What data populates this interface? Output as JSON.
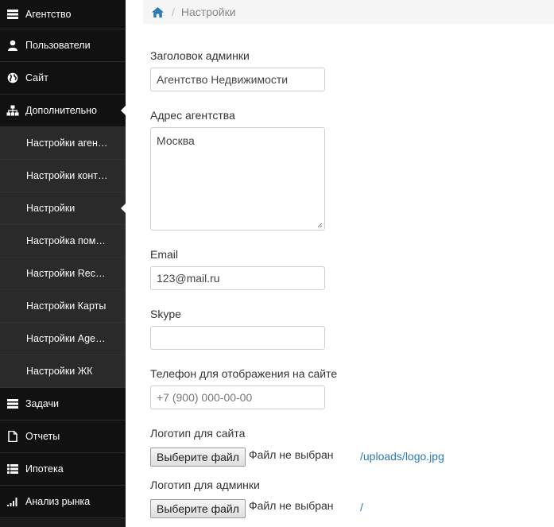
{
  "sidebar": {
    "items": [
      {
        "label": "Агентство",
        "icon": "agency-icon"
      },
      {
        "label": "Пользователи",
        "icon": "user-icon"
      },
      {
        "label": "Сайт",
        "icon": "globe-icon"
      },
      {
        "label": "Дополнительно",
        "icon": "sitemap-icon"
      }
    ],
    "sub_items": [
      {
        "label": "Настройки агентства"
      },
      {
        "label": "Настройки контракта"
      },
      {
        "label": "Настройки"
      },
      {
        "label": "Настройка помощника"
      },
      {
        "label": "Настройки Recaptcha"
      },
      {
        "label": "Настройки Карты"
      },
      {
        "label": "Настройки Agency"
      },
      {
        "label": "Настройки ЖК"
      }
    ],
    "bottom_items": [
      {
        "label": "Задачи",
        "icon": "tasks-icon"
      },
      {
        "label": "Отчеты",
        "icon": "document-icon"
      },
      {
        "label": "Ипотека",
        "icon": "list-icon"
      },
      {
        "label": "Анализ рынка",
        "icon": "signal-bars-icon"
      }
    ]
  },
  "breadcrumb": {
    "current": "Настройки"
  },
  "form": {
    "admin_title": {
      "label": "Заголовок админки",
      "value": "Агентство Недвижимости"
    },
    "address": {
      "label": "Адрес агентства",
      "value": "Москва"
    },
    "email": {
      "label": "Email",
      "value": "123@mail.ru"
    },
    "skype": {
      "label": "Skype",
      "value": ""
    },
    "phone": {
      "label": "Телефон для отображения на сайте",
      "placeholder": "+7 (900) 000-00-00"
    },
    "site_logo": {
      "label": "Логотип для сайта",
      "button": "Выберите файл",
      "status": "Файл не выбран",
      "path": "/uploads/logo.jpg"
    },
    "admin_logo": {
      "label": "Логотип для админки",
      "button": "Выберите файл",
      "status": "Файл не выбран",
      "path": "/"
    }
  },
  "colors": {
    "sidebar_bg": "#1a1a1a",
    "submenu_bg": "#2a2a2a",
    "link": "#2a7ab8",
    "home_icon": "#2a7ab8"
  }
}
